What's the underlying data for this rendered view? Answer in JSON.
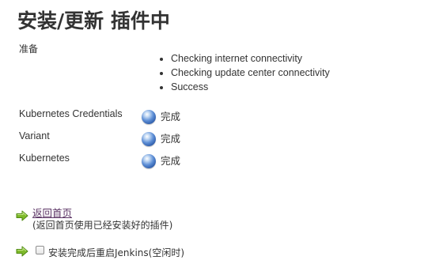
{
  "page": {
    "title": "安装/更新 插件中"
  },
  "preparation": {
    "label": "准备",
    "steps": [
      "Checking internet connectivity",
      "Checking update center connectivity",
      "Success"
    ]
  },
  "plugins": [
    {
      "name": "Kubernetes Credentials",
      "status": "完成",
      "status_icon": "blue-ball-icon"
    },
    {
      "name": "Variant",
      "status": "完成",
      "status_icon": "blue-ball-icon"
    },
    {
      "name": "Kubernetes",
      "status": "完成",
      "status_icon": "blue-ball-icon"
    }
  ],
  "actions": {
    "back_link": "返回首页",
    "back_note": "(返回首页使用已经安装好的插件)",
    "restart_label": "安装完成后重启Jenkins(空闲时)",
    "restart_checked": false,
    "arrow_icon": "green-arrow-icon"
  },
  "colors": {
    "link": "#5c3566",
    "arrow_green": "#7fba2b",
    "ball_blue": "#2c5aa8"
  }
}
